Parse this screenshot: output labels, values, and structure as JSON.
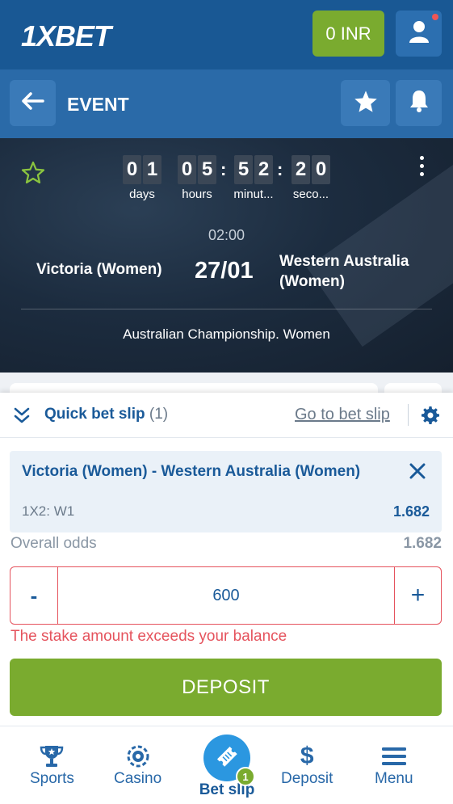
{
  "header": {
    "logo_text": "1XBET",
    "balance": "0 INR"
  },
  "event_bar": {
    "title": "EVENT"
  },
  "event": {
    "countdown": {
      "days": [
        "0",
        "1"
      ],
      "hours": [
        "0",
        "5"
      ],
      "minutes": [
        "5",
        "2"
      ],
      "seconds": [
        "2",
        "0"
      ],
      "days_label": "days",
      "hours_label": "hours",
      "minutes_label": "minut...",
      "seconds_label": "seco..."
    },
    "time": "02:00",
    "date": "27/01",
    "team1": "Victoria (Women)",
    "team2": "Western Australia (Women)",
    "league": "Australian Championship. Women"
  },
  "quick_bet": {
    "title": "Quick bet slip",
    "count": "(1)",
    "go_to_label": "Go to bet slip",
    "bet": {
      "match": "Victoria (Women) - Western Australia (Women)",
      "market": "1X2: W1",
      "odds": "1.682"
    },
    "overall_label": "Overall odds",
    "overall_value": "1.682",
    "stake_minus": "-",
    "stake_value": "600",
    "stake_plus": "+",
    "error": "The stake amount exceeds your balance",
    "deposit_label": "DEPOSIT"
  },
  "nav": {
    "sports": "Sports",
    "casino": "Casino",
    "betslip": "Bet slip",
    "betslip_badge": "1",
    "deposit": "Deposit",
    "menu": "Menu"
  },
  "colors": {
    "brand_blue": "#195894",
    "accent_green": "#7aab2f",
    "error_red": "#e5535d"
  }
}
